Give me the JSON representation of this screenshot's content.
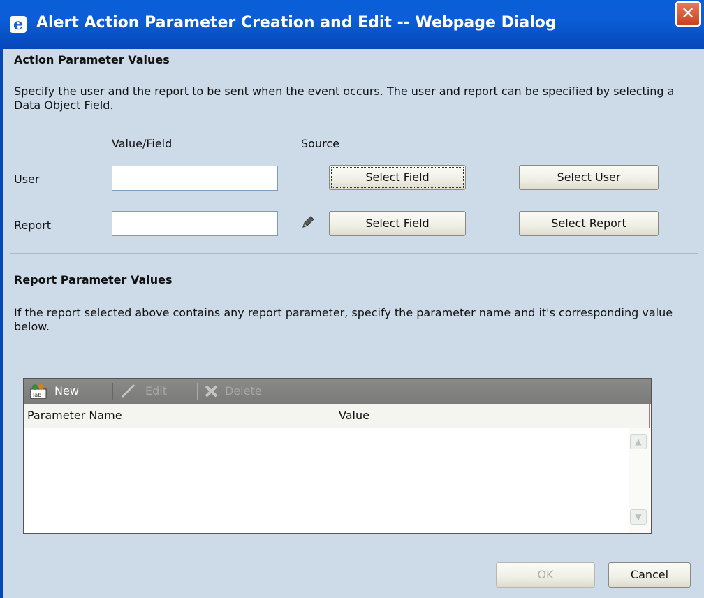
{
  "window": {
    "title": "Alert Action Parameter Creation and Edit -- Webpage Dialog",
    "app_icon": "ie-icon",
    "close_glyph": "✕"
  },
  "action_section": {
    "heading": "Action Parameter Values",
    "description": "Specify the user and the report to be sent when the event occurs. The user and report can be specified by selecting a Data Object Field.",
    "col_value_field": "Value/Field",
    "col_source": "Source",
    "user_label": "User",
    "user_value": "",
    "report_label": "Report",
    "report_value": "",
    "select_field_label": "Select Field",
    "select_user_label": "Select User",
    "select_report_label": "Select Report"
  },
  "report_section": {
    "heading": "Report Parameter Values",
    "description": "If the report selected above contains any report parameter, specify the parameter name and it's corresponding value below.",
    "toolbar": {
      "new_label": "New",
      "edit_label": "Edit",
      "delete_label": "Delete"
    },
    "columns": [
      "Parameter Name",
      "Value"
    ],
    "rows": []
  },
  "footer": {
    "ok_label": "OK",
    "cancel_label": "Cancel"
  }
}
